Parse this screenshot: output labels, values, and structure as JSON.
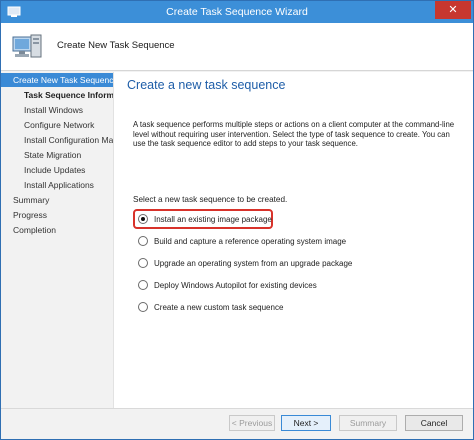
{
  "window": {
    "title": "Create Task Sequence Wizard",
    "close_glyph": "✕"
  },
  "header": {
    "title": "Create New Task Sequence",
    "icon": "computer-wizard-icon"
  },
  "nav": {
    "items": [
      {
        "label": "Create New Task Sequence",
        "state": "active"
      },
      {
        "label": "Task Sequence Information",
        "state": "selected"
      },
      {
        "label": "Install Windows",
        "state": "normal"
      },
      {
        "label": "Configure Network",
        "state": "normal"
      },
      {
        "label": "Install Configuration Manager",
        "state": "normal"
      },
      {
        "label": "State Migration",
        "state": "normal"
      },
      {
        "label": "Include Updates",
        "state": "normal"
      },
      {
        "label": "Install Applications",
        "state": "normal"
      },
      {
        "label": "Summary",
        "state": "top"
      },
      {
        "label": "Progress",
        "state": "top"
      },
      {
        "label": "Completion",
        "state": "top"
      }
    ]
  },
  "content": {
    "heading": "Create a new task sequence",
    "description": "A task sequence performs multiple steps or actions on a client computer at the command-line level without requiring user intervention. Select the type of task sequence to create. You can use the task sequence editor to add steps to your task sequence.",
    "prompt": "Select a new task sequence to be created.",
    "options": [
      {
        "label": "Install an existing image package",
        "checked": true
      },
      {
        "label": "Build and capture a reference operating system image",
        "checked": false
      },
      {
        "label": "Upgrade an operating system from an upgrade package",
        "checked": false
      },
      {
        "label": "Deploy Windows Autopilot for existing devices",
        "checked": false
      },
      {
        "label": "Create a new custom task sequence",
        "checked": false
      }
    ]
  },
  "footer": {
    "previous": "< Previous",
    "next": "Next >",
    "summary": "Summary",
    "cancel": "Cancel"
  },
  "colors": {
    "titlebar": "#3c8fd8",
    "nav_active": "#3a8ad6",
    "heading": "#1f5ea8",
    "highlight": "#d8322a",
    "close": "#c7372f"
  }
}
